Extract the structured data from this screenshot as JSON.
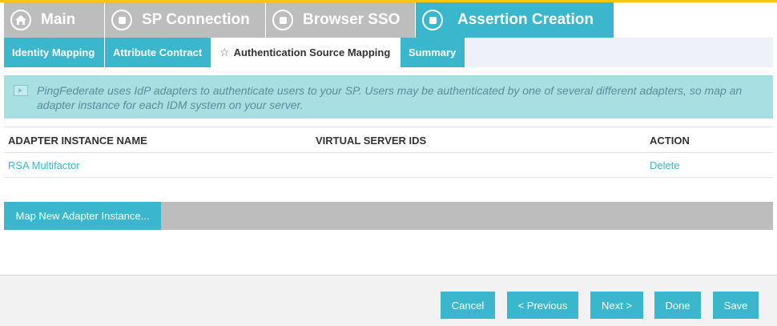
{
  "primary_tabs": [
    {
      "label": "Main",
      "icon": "home-icon",
      "active": false
    },
    {
      "label": "SP Connection",
      "icon": "square-icon",
      "active": false
    },
    {
      "label": "Browser SSO",
      "icon": "square-icon",
      "active": false
    },
    {
      "label": "Assertion Creation",
      "icon": "square-icon",
      "active": true
    }
  ],
  "secondary_tabs": [
    {
      "label": "Identity Mapping",
      "active": false
    },
    {
      "label": "Attribute Contract",
      "active": false
    },
    {
      "label": "Authentication Source Mapping",
      "active": true,
      "icon": "star-icon"
    },
    {
      "label": "Summary",
      "active": false
    }
  ],
  "info": {
    "icon": "info-icon",
    "text": "PingFederate uses IdP adapters to authenticate users to your SP. Users may be authenticated by one of several different adapters, so map an adapter instance for each IDM system on your server."
  },
  "table": {
    "headers": [
      "ADAPTER INSTANCE NAME",
      "VIRTUAL SERVER IDS",
      "ACTION"
    ],
    "rows": [
      {
        "name": "RSA Multifactor",
        "virtual_server_ids": "",
        "action": "Delete"
      }
    ]
  },
  "map_button": "Map New Adapter Instance...",
  "footer": {
    "cancel": "Cancel",
    "previous": "< Previous",
    "next": "Next >",
    "done": "Done",
    "save": "Save"
  },
  "colors": {
    "accent": "#3ab7cc",
    "inactive_tab": "#bdbdbd",
    "info_bg": "#a8dfe2",
    "top_line": "#f5c518"
  }
}
